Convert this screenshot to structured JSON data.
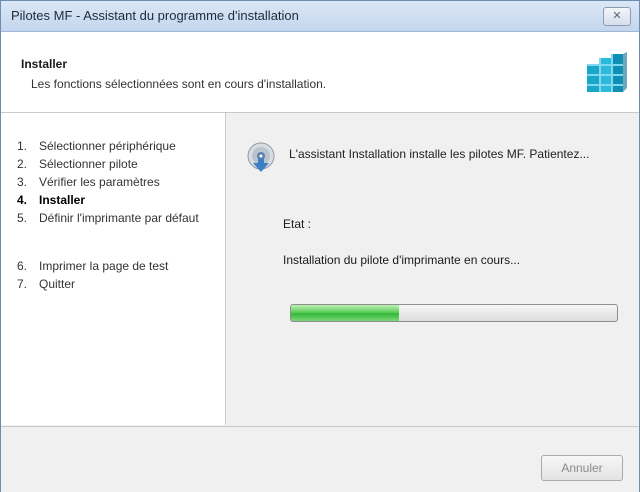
{
  "window": {
    "title": "Pilotes MF - Assistant du programme d'installation",
    "close_label": "✕"
  },
  "header": {
    "title": "Installer",
    "subtitle": "Les fonctions sélectionnées sont en cours d'installation."
  },
  "steps": [
    {
      "num": "1.",
      "label": "Sélectionner périphérique",
      "active": false
    },
    {
      "num": "2.",
      "label": "Sélectionner pilote",
      "active": false
    },
    {
      "num": "3.",
      "label": "Vérifier les paramètres",
      "active": false
    },
    {
      "num": "4.",
      "label": "Installer",
      "active": true
    },
    {
      "num": "5.",
      "label": "Définir l'imprimante par défaut",
      "active": false
    },
    {
      "num": "6.",
      "label": "Imprimer la page de test",
      "active": false
    },
    {
      "num": "7.",
      "label": "Quitter",
      "active": false
    }
  ],
  "main": {
    "message": "L'assistant Installation installe les pilotes MF. Patientez...",
    "state_label": "Etat :",
    "status_text": "Installation du pilote d'imprimante en cours...",
    "progress_percent": 33
  },
  "footer": {
    "cancel_label": "Annuler"
  },
  "colors": {
    "progress": "#36b83a",
    "title_bg": "#c4d6ee"
  },
  "icons": {
    "logo": "cubes-logo-icon",
    "disc": "install-disc-icon"
  }
}
